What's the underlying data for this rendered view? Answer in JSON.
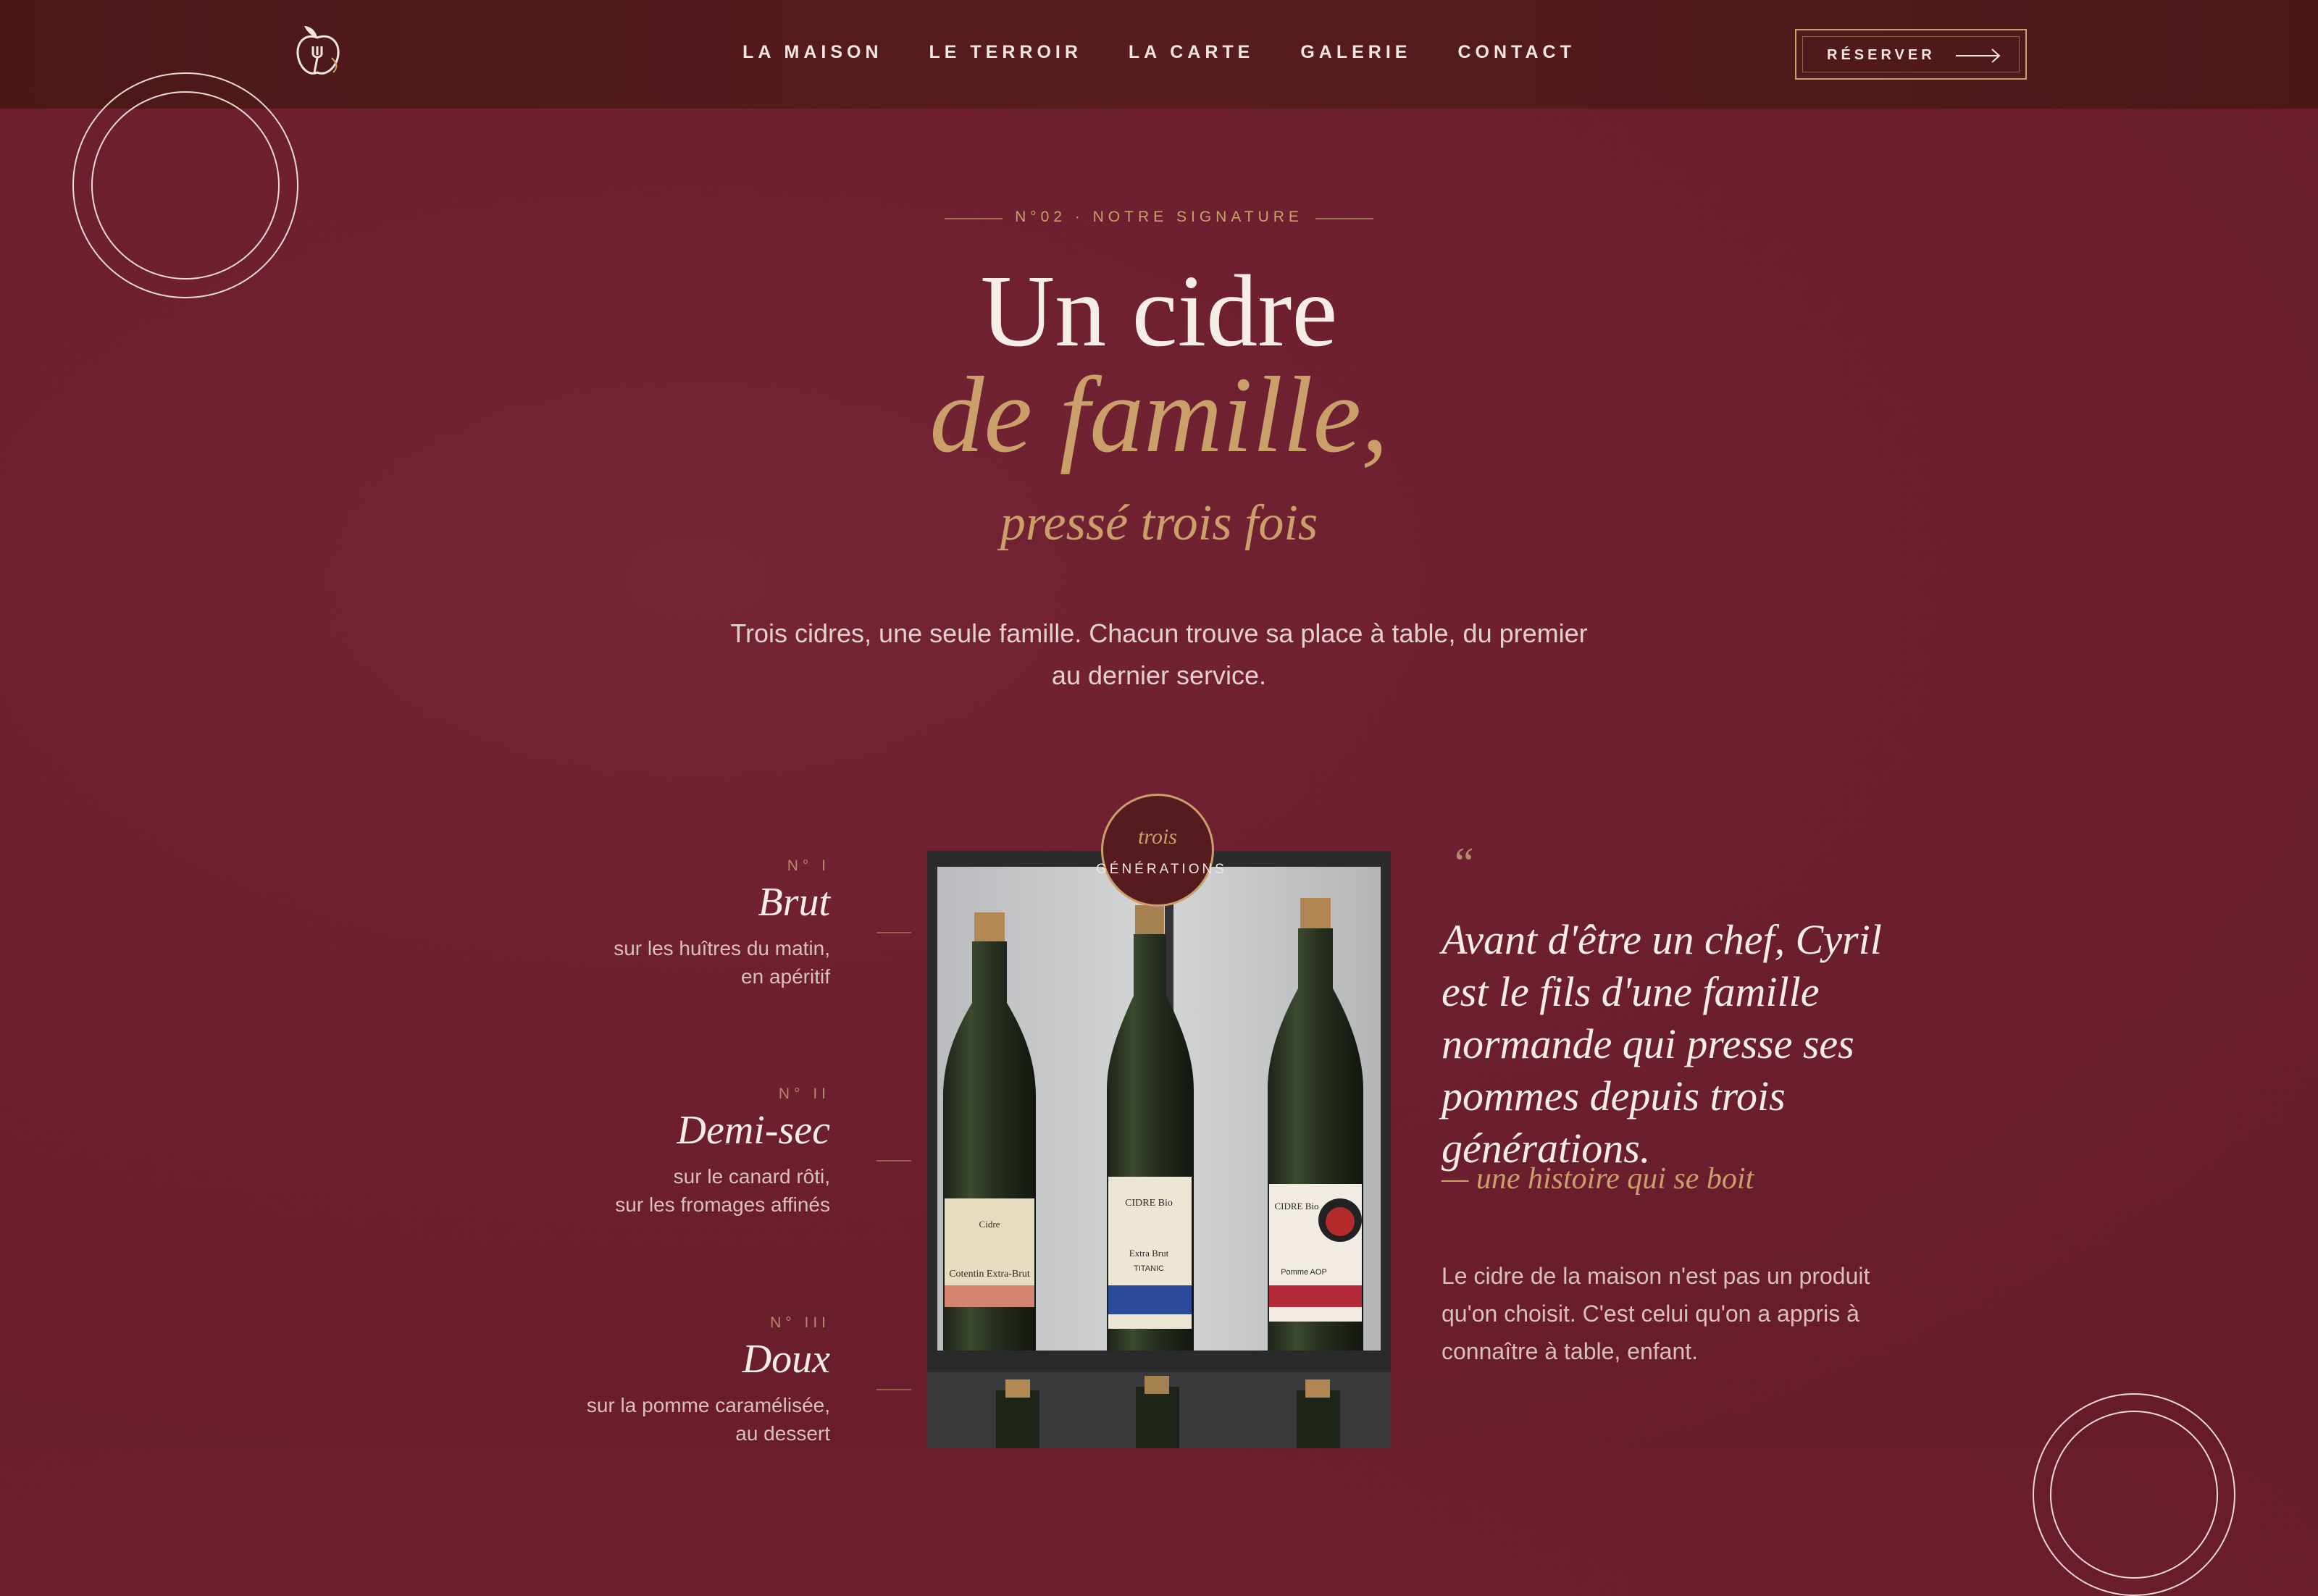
{
  "header": {
    "nav": [
      "LA MAISON",
      "LE TERROIR",
      "LA CARTE",
      "GALERIE",
      "CONTACT"
    ],
    "reserve_label": "RÉSERVER"
  },
  "hero": {
    "eyebrow": "N°02 · NOTRE SIGNATURE",
    "title_line1": "Un cidre",
    "title_line2": "de famille,",
    "title_line3": "pressé trois fois",
    "intro": "Trois cidres, une seule famille. Chacun trouve sa place à table, du premier au dernier service."
  },
  "ciders": [
    {
      "num": "N° I",
      "name": "Brut",
      "desc_line1": "sur les huîtres du matin,",
      "desc_line2": "en apéritif"
    },
    {
      "num": "N° II",
      "name": "Demi-sec",
      "desc_line1": "sur le canard rôti,",
      "desc_line2": "sur les fromages affinés"
    },
    {
      "num": "N° III",
      "name": "Doux",
      "desc_line1": "sur la pomme caramélisée,",
      "desc_line2": "au dessert"
    }
  ],
  "badge": {
    "top": "trois",
    "bottom": "GÉNÉRATIONS"
  },
  "photo": {
    "label1_a": "Cidre",
    "label1_b": "Cotentin Extra-Brut",
    "label2_a": "CIDRE Bio",
    "label2_b": "Extra Brut",
    "label2_c": "TITANIC",
    "label3_a": "CIDRE Bio",
    "label3_b": "Pomme AOP"
  },
  "quote": {
    "mark": "“",
    "text": "Avant d'être un chef, Cyril est le fils d'une famille normande qui presse ses pommes depuis trois générations.",
    "signature": "— une histoire qui se boit",
    "body": "Le cidre de la maison n'est pas un produit qu'on choisit. C'est celui qu'on a appris à connaître à table, enfant."
  },
  "colors": {
    "background": "#6c1f2f",
    "header": "#511a1b",
    "accent_gold": "#c9a06a",
    "text": "#f3e6e2"
  },
  "icons": {
    "logo": "apple-fork-logo-icon",
    "arrow": "arrow-right-icon",
    "quote": "quote-mark-icon"
  }
}
